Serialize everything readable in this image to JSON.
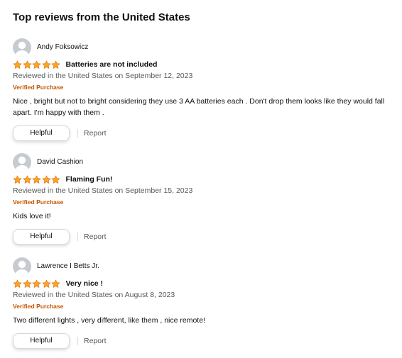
{
  "section": {
    "title": "Top reviews from the United States"
  },
  "colors": {
    "star": "#ffa41c",
    "verified": "#c45500",
    "meta": "#565959",
    "text": "#0f1111",
    "avatar": "#c7cbd1"
  },
  "reviews": [
    {
      "reviewer": "Andy Foksowicz",
      "rating": 5,
      "title": "Batteries are not included",
      "date": "Reviewed in the United States on September 12, 2023",
      "verified": "Verified Purchase",
      "body": "Nice , bright but not to bright considering they use 3 AA batteries each . Don't drop them looks like they would fall apart. I'm happy with them .",
      "helpful_label": "Helpful",
      "report_label": "Report"
    },
    {
      "reviewer": "David Cashion",
      "rating": 5,
      "title": "Flaming Fun!",
      "date": "Reviewed in the United States on September 15, 2023",
      "verified": "Verified Purchase",
      "body": "Kids love it!",
      "helpful_label": "Helpful",
      "report_label": "Report"
    },
    {
      "reviewer": "Lawrence I Betts Jr.",
      "rating": 5,
      "title": "Very nice !",
      "date": "Reviewed in the United States on August 8, 2023",
      "verified": "Verified Purchase",
      "body": "Two different lights , very different, like them , nice remote!",
      "helpful_label": "Helpful",
      "report_label": "Report"
    }
  ]
}
